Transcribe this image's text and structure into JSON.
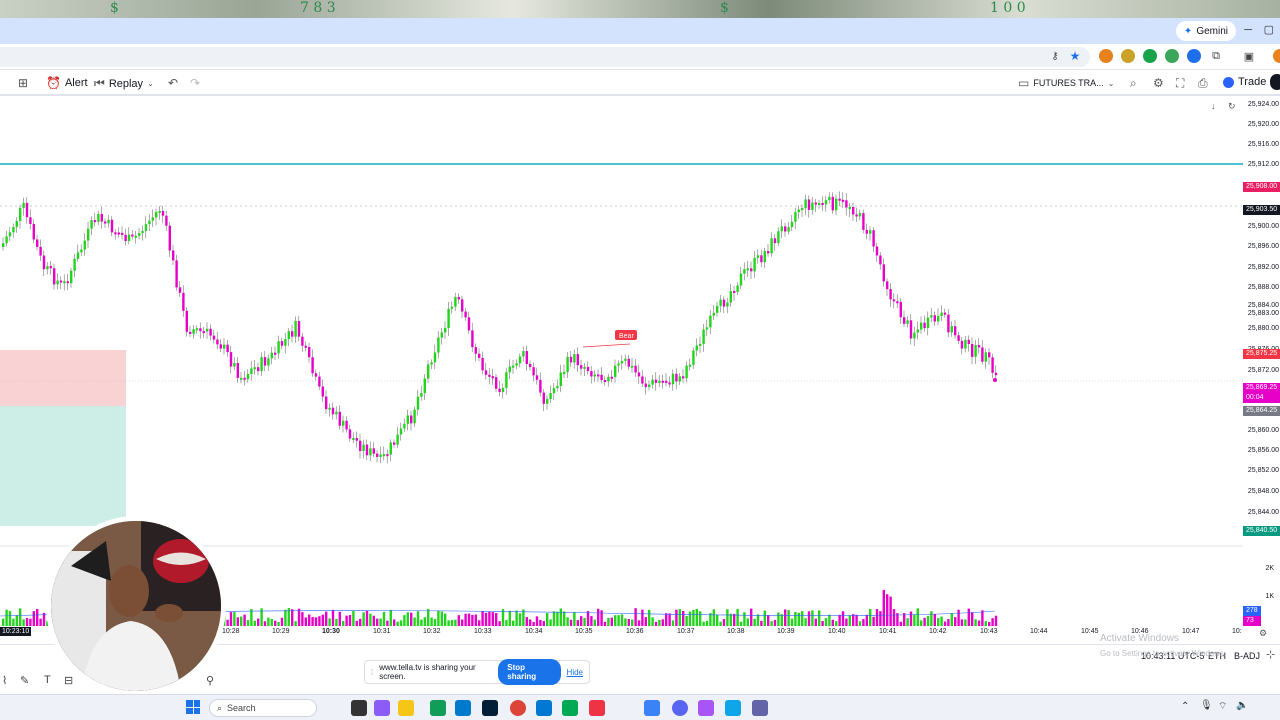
{
  "browser": {
    "gemini_label": "Gemini"
  },
  "toolbar": {
    "alert_label": "Alert",
    "replay_label": "Replay",
    "layout_name": "FUTURES TRA...",
    "trade_label": "Trade"
  },
  "chart": {
    "bear_label": "Bear",
    "price_labels": [
      "25,924.00",
      "25,920.00",
      "25,916.00",
      "25,912.00",
      "25,908.00",
      "25,903.50",
      "25,900.00",
      "25,896.00",
      "25,892.00",
      "25,888.00",
      "25,884.00",
      "25,883.00",
      "25,880.00",
      "25,876.00",
      "25,875.25",
      "25,872.00",
      "25,869.25",
      "25,864.25",
      "25,860.00",
      "25,856.00",
      "25,852.00",
      "25,848.00",
      "25,844.00",
      "25,840.50"
    ],
    "countdown": "00:04",
    "volume_labels": [
      "2K",
      "1K"
    ],
    "volume_badges": [
      "278",
      "73"
    ],
    "time_labels": [
      "10:23:10",
      "10:28",
      "10:29",
      "10:30",
      "10:31",
      "10:32",
      "10:33",
      "10:34",
      "10:35",
      "10:36",
      "10:37",
      "10:38",
      "10:39",
      "10:40",
      "10:41",
      "10:42",
      "10:43",
      "10:44",
      "10:45",
      "10:46",
      "10:47",
      "10:"
    ]
  },
  "status": {
    "clock": "10:43:11 UTC-5",
    "eth": "ETH",
    "badj": "B-ADJ"
  },
  "watermark": {
    "line1": "Activate Windows",
    "line2": "Go to Settings to activate Windows."
  },
  "share": {
    "message": "www.tella.tv is sharing your screen.",
    "stop_label": "Stop sharing",
    "hide_label": "Hide"
  },
  "taskbar": {
    "search_placeholder": "Search"
  },
  "colors": {
    "bull": "#22d41c",
    "bear": "#e600c8",
    "cyan_line": "#4fc3d6",
    "red_zone": "#f9d3d3",
    "green_zone": "#cdeee6"
  }
}
